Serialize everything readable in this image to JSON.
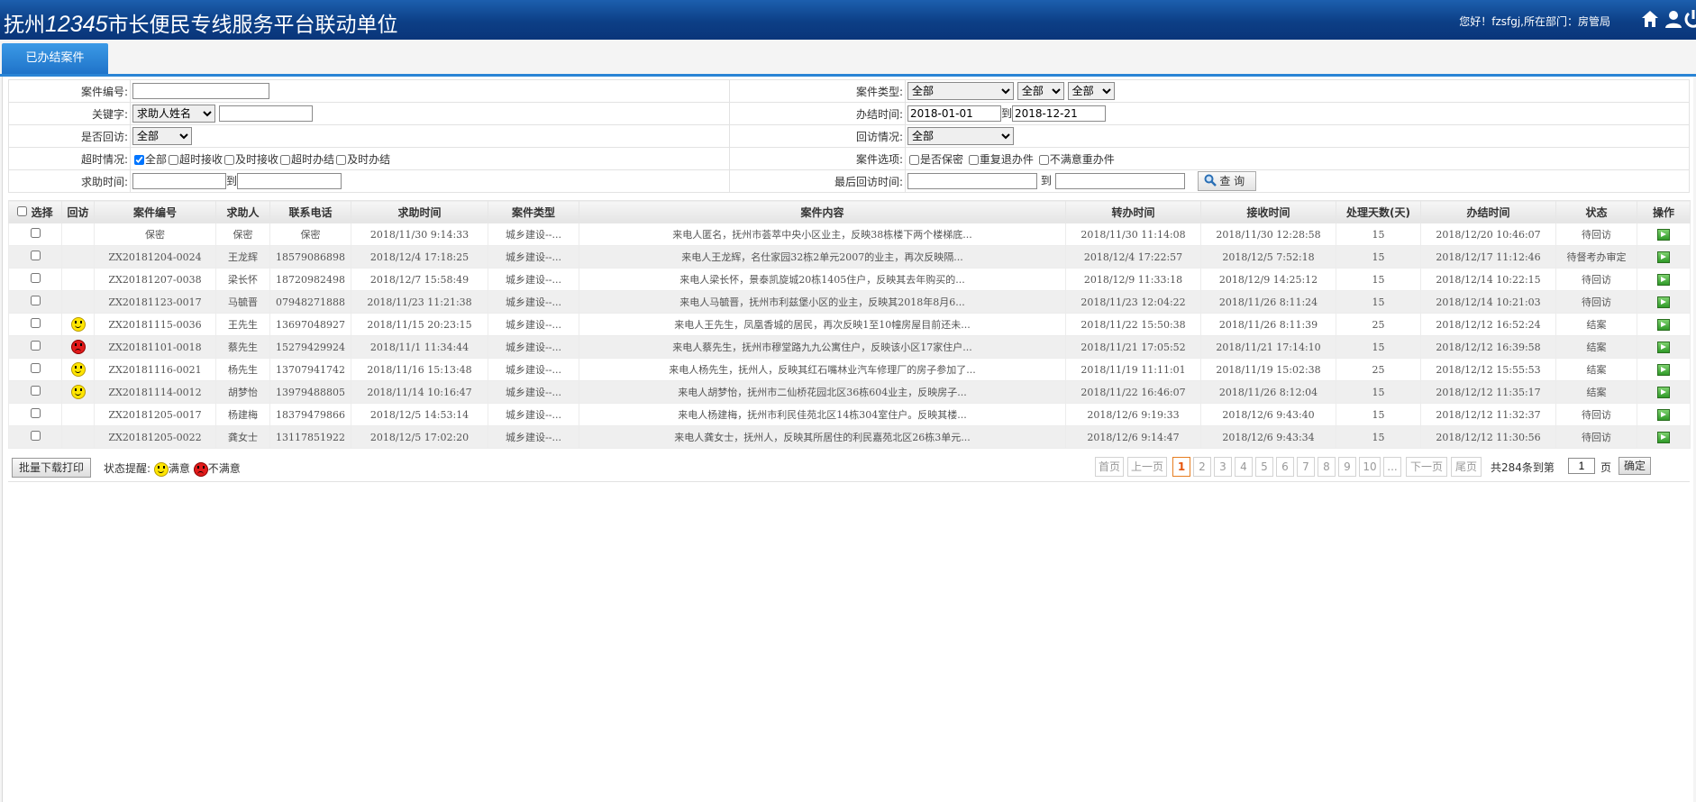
{
  "header": {
    "title_prefix": "抚州",
    "title_number": "12345",
    "title_suffix": "市长便民专线服务平台联动单位",
    "user_text": "您好！fzsfgj,所在部门：房管局",
    "icons": [
      "home-icon",
      "user-icon",
      "power-icon"
    ]
  },
  "tab": {
    "label": "已办结案件"
  },
  "search": {
    "case_no_label": "案件编号:",
    "case_type_label": "案件类型:",
    "case_type_selects": [
      "全部",
      "全部",
      "全部"
    ],
    "keyword_label": "关键字:",
    "keyword_select": "求助人姓名",
    "finish_time_label": "办结时间:",
    "finish_from": "2018-01-01",
    "to_text": "到",
    "finish_to": "2018-12-21",
    "revisit_label": "是否回访:",
    "revisit_select": "全部",
    "revisit_status_label": "回访情况:",
    "revisit_status_select": "全部",
    "overtime_label": "超时情况:",
    "overtime_options": [
      "全部",
      "超时接收",
      "及时接收",
      "超时办结",
      "及时办结"
    ],
    "case_opts_label": "案件选项:",
    "case_opts": [
      "是否保密",
      "重复退办件",
      "不满意重办件"
    ],
    "help_time_label": "求助时间:",
    "last_revisit_label": "最后回访时间:",
    "query_button": "查 询"
  },
  "grid": {
    "headers": [
      "选择",
      "回访",
      "案件编号",
      "求助人",
      "联系电话",
      "求助时间",
      "案件类型",
      "案件内容",
      "转办时间",
      "接收时间",
      "处理天数(天)",
      "办结时间",
      "状态",
      "操作"
    ],
    "rows": [
      {
        "face": "",
        "no": "保密",
        "person": "保密",
        "phone": "保密",
        "help_time": "2018/11/30 9:14:33",
        "type": "城乡建设--...",
        "content": "来电人匿名，抚州市荟萃中央小区业主，反映38栋楼下两个楼梯底...",
        "transfer": "2018/11/30 11:14:08",
        "receive": "2018/11/30 12:28:58",
        "days": "15",
        "finish": "2018/12/20 10:46:07",
        "status": "待回访"
      },
      {
        "face": "",
        "no": "ZX20181204-0024",
        "person": "王龙辉",
        "phone": "18579086898",
        "help_time": "2018/12/4 17:18:25",
        "type": "城乡建设--...",
        "content": "来电人王龙辉，名仕家园32栋2单元2007的业主，再次反映隔...",
        "transfer": "2018/12/4 17:22:57",
        "receive": "2018/12/5 7:52:18",
        "days": "15",
        "finish": "2018/12/17 11:12:46",
        "status": "待督考办审定"
      },
      {
        "face": "",
        "no": "ZX20181207-0038",
        "person": "梁长怀",
        "phone": "18720982498",
        "help_time": "2018/12/7 15:58:49",
        "type": "城乡建设--...",
        "content": "来电人梁长怀，景泰凯旋城20栋1405住户，反映其去年购买的...",
        "transfer": "2018/12/9 11:33:18",
        "receive": "2018/12/9 14:25:12",
        "days": "15",
        "finish": "2018/12/14 10:22:15",
        "status": "待回访"
      },
      {
        "face": "",
        "no": "ZX20181123-0017",
        "person": "马毓晋",
        "phone": "07948271888",
        "help_time": "2018/11/23 11:21:38",
        "type": "城乡建设--...",
        "content": "来电人马毓晋，抚州市利兹堡小区的业主，反映其2018年8月6...",
        "transfer": "2018/11/23 12:04:22",
        "receive": "2018/11/26 8:11:24",
        "days": "15",
        "finish": "2018/12/14 10:21:03",
        "status": "待回访"
      },
      {
        "face": "ok",
        "no": "ZX20181115-0036",
        "person": "王先生",
        "phone": "13697048927",
        "help_time": "2018/11/15 20:23:15",
        "type": "城乡建设--...",
        "content": "来电人王先生，凤凰香城的居民，再次反映1至10幢房屋目前还未...",
        "transfer": "2018/11/22 15:50:38",
        "receive": "2018/11/26 8:11:39",
        "days": "25",
        "finish": "2018/12/12 16:52:24",
        "status": "结案"
      },
      {
        "face": "bad",
        "no": "ZX20181101-0018",
        "person": "蔡先生",
        "phone": "15279429924",
        "help_time": "2018/11/1 11:34:44",
        "type": "城乡建设--...",
        "content": "来电人蔡先生，抚州市穆堂路九九公寓住户，反映该小区17家住户...",
        "transfer": "2018/11/21 17:05:52",
        "receive": "2018/11/21 17:14:10",
        "days": "15",
        "finish": "2018/12/12 16:39:58",
        "status": "结案"
      },
      {
        "face": "ok",
        "no": "ZX20181116-0021",
        "person": "杨先生",
        "phone": "13707941742",
        "help_time": "2018/11/16 15:13:48",
        "type": "城乡建设--...",
        "content": "来电人杨先生，抚州人，反映其红石嘴林业汽车修理厂的房子参加了...",
        "transfer": "2018/11/19 11:11:01",
        "receive": "2018/11/19 15:02:38",
        "days": "25",
        "finish": "2018/12/12 15:55:53",
        "status": "结案"
      },
      {
        "face": "ok",
        "no": "ZX20181114-0012",
        "person": "胡梦怡",
        "phone": "13979488805",
        "help_time": "2018/11/14 10:16:47",
        "type": "城乡建设--...",
        "content": "来电人胡梦怡，抚州市二仙桥花园北区36栋604业主，反映房子...",
        "transfer": "2018/11/22 16:46:07",
        "receive": "2018/11/26 8:12:04",
        "days": "15",
        "finish": "2018/12/12 11:35:17",
        "status": "结案"
      },
      {
        "face": "",
        "no": "ZX20181205-0017",
        "person": "杨建梅",
        "phone": "18379479866",
        "help_time": "2018/12/5 14:53:14",
        "type": "城乡建设--...",
        "content": "来电人杨建梅，抚州市利民佳苑北区14栋304室住户。反映其楼...",
        "transfer": "2018/12/6 9:19:33",
        "receive": "2018/12/6 9:43:40",
        "days": "15",
        "finish": "2018/12/12 11:32:37",
        "status": "待回访"
      },
      {
        "face": "",
        "no": "ZX20181205-0022",
        "person": "龚女士",
        "phone": "13117851922",
        "help_time": "2018/12/5 17:02:20",
        "type": "城乡建设--...",
        "content": "来电人龚女士，抚州人，反映其所居住的利民嘉苑北区26栋3单元...",
        "transfer": "2018/12/6 9:14:47",
        "receive": "2018/12/6 9:43:34",
        "days": "15",
        "finish": "2018/12/12 11:30:56",
        "status": "待回访"
      }
    ]
  },
  "footer": {
    "batch_button": "批量下载打印",
    "legend_label": "状态提醒:",
    "legend_ok": "满意",
    "legend_bad": "不满意"
  },
  "pager": {
    "first": "首页",
    "prev": "上一页",
    "pages": [
      "1",
      "2",
      "3",
      "4",
      "5",
      "6",
      "7",
      "8",
      "9",
      "10",
      "..."
    ],
    "current": "1",
    "next": "下一页",
    "last": "尾页",
    "total_text": "共284条到第",
    "page_input": "1",
    "page_unit": "页",
    "go_button": "确定"
  }
}
